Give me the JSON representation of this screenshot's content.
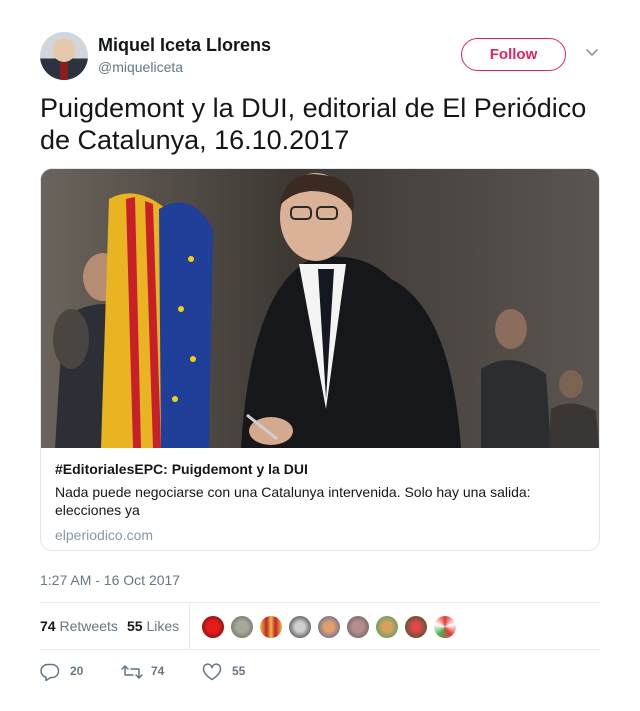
{
  "author": {
    "display_name": "Miquel Iceta Llorens",
    "handle": "@miqueliceta",
    "follow_label": "Follow"
  },
  "tweet": {
    "text": "Puigdemont y la DUI, editorial de El Periódico de Catalunya, 16.10.2017"
  },
  "card": {
    "title": "#EditorialesEPC: Puigdemont y la DUI",
    "description": "Nada puede negociarse con una Catalunya intervenida. Solo hay una salida: elecciones ya",
    "domain": "elperiodico.com"
  },
  "timestamp": "1:27 AM - 16 Oct 2017",
  "stats": {
    "retweets_count": "74",
    "retweets_label": "Retweets",
    "likes_count": "55",
    "likes_label": "Likes"
  },
  "actions": {
    "reply_count": "20",
    "retweet_count": "74",
    "like_count": "55"
  },
  "colors": {
    "accent": "#e0245e",
    "muted": "#657786",
    "text": "#14171a"
  },
  "icons": [
    "caret-down-icon",
    "reply-icon",
    "retweet-icon",
    "heart-icon"
  ]
}
